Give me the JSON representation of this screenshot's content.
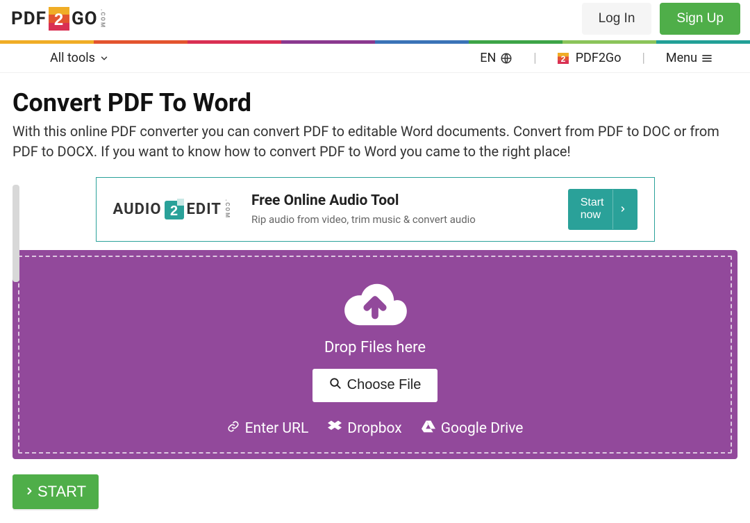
{
  "header": {
    "brand_part1": "PDF",
    "brand_part2": "GO",
    "brand_tld": ".COM",
    "login": "Log In",
    "signup": "Sign Up"
  },
  "strip_colors": [
    "#f0ad26",
    "#e3542f",
    "#d93053",
    "#8a398f",
    "#3a73b7",
    "#3da447",
    "#8bc45a",
    "#22a097"
  ],
  "nav": {
    "all_tools": "All tools",
    "lang": "EN",
    "brand": "PDF2Go",
    "menu": "Menu"
  },
  "page": {
    "title": "Convert PDF To Word",
    "subtitle": "With this online PDF converter you can convert PDF to editable Word documents. Convert from PDF to DOC or from PDF to DOCX. If you want to know how to convert PDF to Word you came to the right place!"
  },
  "ad": {
    "logo_part1": "AUDIO",
    "logo_part2": "EDIT",
    "logo_tld": ".COM",
    "title": "Free Online Audio Tool",
    "subtitle": "Rip audio from video, trim music & convert audio",
    "cta": "Start\nnow"
  },
  "drop": {
    "text": "Drop Files here",
    "choose": "Choose File",
    "url": "Enter URL",
    "dropbox": "Dropbox",
    "gdrive": "Google Drive"
  },
  "start": "START"
}
